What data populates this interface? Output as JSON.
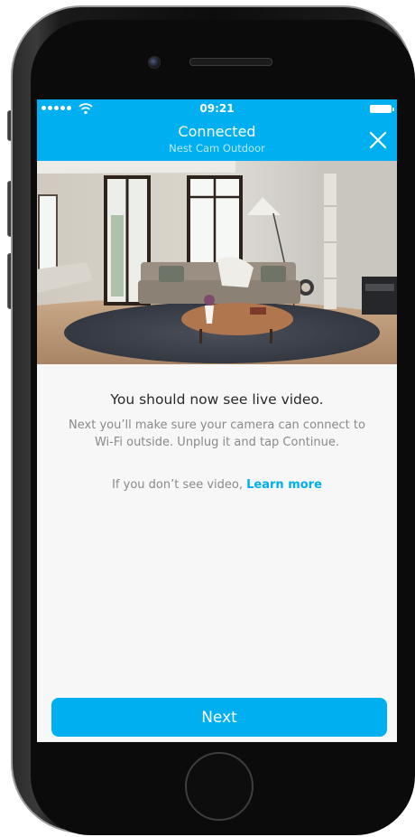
{
  "status_bar": {
    "time": "09:21"
  },
  "nav": {
    "title": "Connected",
    "subtitle": "Nest Cam Outdoor"
  },
  "content": {
    "headline": "You should now see live video.",
    "body": "Next you’ll make sure your camera can connect to Wi-Fi outside. Unplug it and tap Continue.",
    "help_prefix": "If you don’t see video,",
    "learn_more": "Learn more"
  },
  "actions": {
    "next_label": "Next"
  },
  "colors": {
    "accent": "#00afef",
    "screen_bg": "#f7f7f7"
  },
  "icons": [
    "signal-dots-icon",
    "wifi-icon",
    "battery-icon",
    "close-icon"
  ]
}
